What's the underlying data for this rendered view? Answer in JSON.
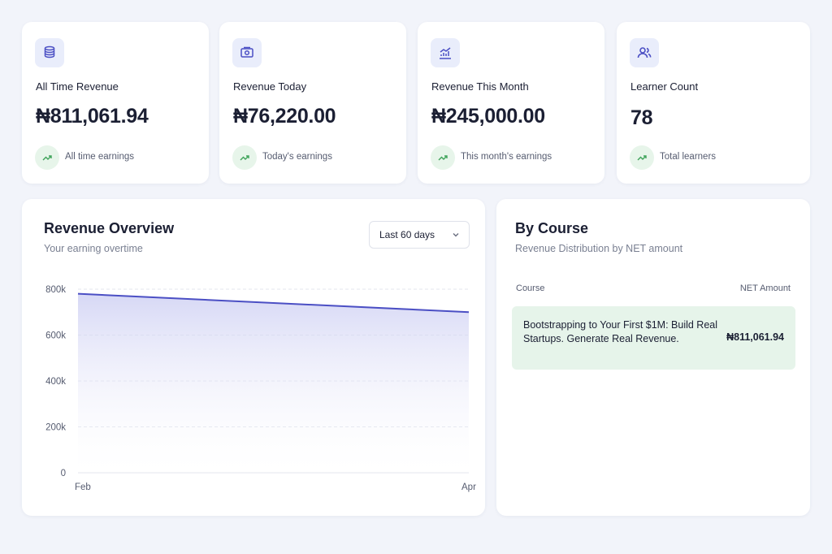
{
  "stats": [
    {
      "label": "All Time Revenue",
      "value": "₦811,061.94",
      "trend": "All time earnings",
      "icon": "coins-icon"
    },
    {
      "label": "Revenue Today",
      "value": "₦76,220.00",
      "trend": "Today's earnings",
      "icon": "money-icon"
    },
    {
      "label": "Revenue This Month",
      "value": "₦245,000.00",
      "trend": "This month's earnings",
      "icon": "bar-chart-icon"
    },
    {
      "label": "Learner Count",
      "value": "78",
      "trend": "Total learners",
      "icon": "users-icon"
    }
  ],
  "overview": {
    "title": "Revenue Overview",
    "subtitle": "Your earning overtime",
    "range": "Last 60 days"
  },
  "by_course": {
    "title": "By Course",
    "subtitle": "Revenue Distribution by NET amount",
    "col_course": "Course",
    "col_net": "NET Amount",
    "rows": [
      {
        "name": "Bootstrapping to Your First $1M: Build Real Startups. Generate Real Revenue.",
        "amount": "₦811,061.94"
      }
    ]
  },
  "colors": {
    "accent": "#4b4fc4",
    "trend_green": "#3fa35a",
    "row_highlight": "#e6f4ea"
  },
  "chart_data": {
    "type": "area",
    "x": [
      "Feb",
      "Apr"
    ],
    "values": [
      780000,
      700000
    ],
    "ytick_labels": [
      "800k",
      "600k",
      "400k",
      "200k",
      "0"
    ],
    "ylim": [
      0,
      800000
    ],
    "grid": true
  }
}
